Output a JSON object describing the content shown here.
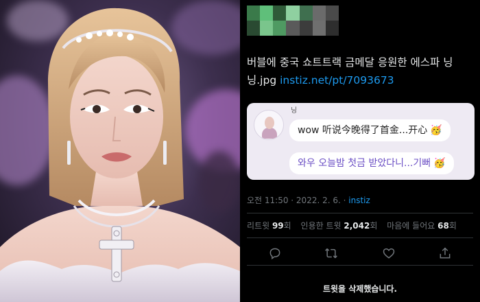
{
  "photo": {
    "icon": "portrait-photo"
  },
  "tweet": {
    "text_main": "버블에 중국 쇼트트랙 금메달 응원한 에스파 닝닝.jpg ",
    "link": "instiz.net/pt/7093673",
    "quote": {
      "name": "닝",
      "bubble_1": "wow 听说今晚得了首金...开心",
      "bubble_1_emoji": "🥳",
      "bubble_2": "와우 오늘밤 첫금 받았다니...기뻐",
      "bubble_2_emoji": "🥳"
    },
    "meta": {
      "time": "오전 11:50 · 2022. 2. 6. · ",
      "source": "instiz"
    },
    "stats": {
      "retweets_label": "리트윗",
      "retweets_count": "99",
      "retweets_unit": "회",
      "quotes_label": "인용한 트윗",
      "quotes_count": "2,042",
      "quotes_unit": "회",
      "likes_label": "마음에 들어요",
      "likes_count": "68",
      "likes_unit": "회"
    },
    "actions": {
      "reply_icon": "reply-icon",
      "retweet_icon": "retweet-icon",
      "like_icon": "heart-icon",
      "share_icon": "share-icon"
    },
    "deleted_notice": "트윗을 삭제했습니다."
  },
  "colors": {
    "link": "#1d9bf0",
    "background": "#000000",
    "muted": "#71767b",
    "avatar_pixels": [
      "#3a7a4a",
      "#5fbf7a",
      "#2f5a38",
      "#8fd0a0",
      "#3f6f4f",
      "#6b6b6b",
      "#4a4a4a",
      "#2a4a32",
      "#7ac58c",
      "#4f9a62",
      "#5a5a5a",
      "#3c3c3c",
      "#6f6f6f",
      "#2e2e2e"
    ]
  }
}
